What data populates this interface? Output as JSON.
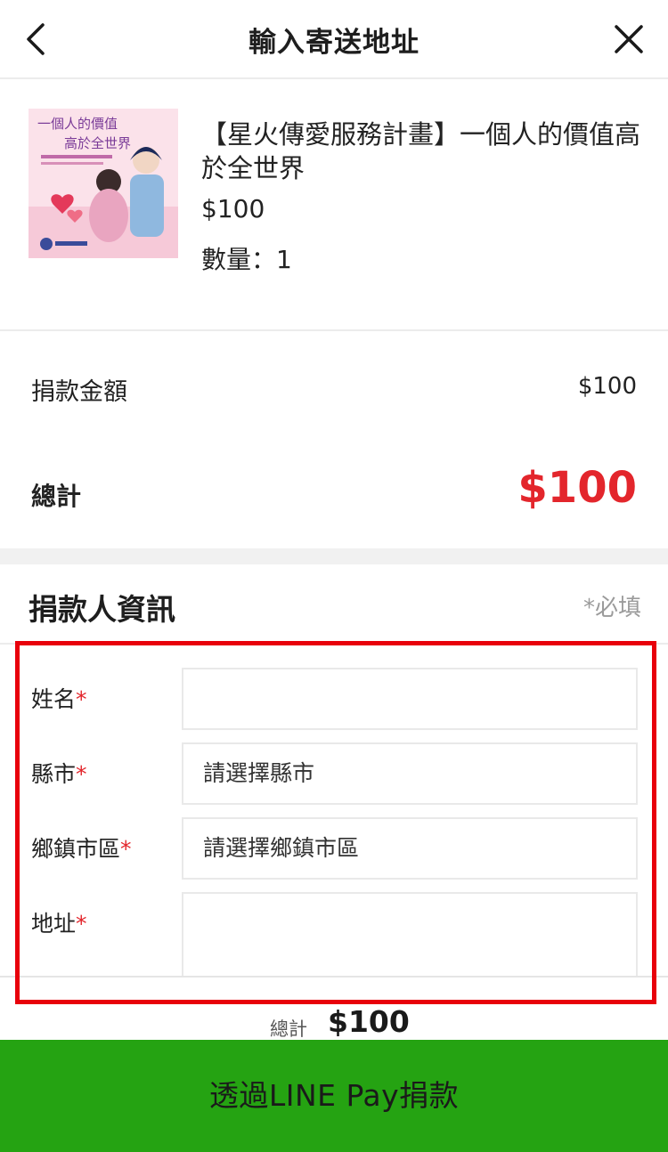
{
  "header": {
    "title": "輸入寄送地址",
    "back_icon": "chevron-left-icon",
    "close_icon": "close-icon"
  },
  "product": {
    "name": "【星火傳愛服務計畫】一個人的價值高於全世界",
    "price": "$100",
    "quantity": "數量：1",
    "thumbnail": {
      "headline_line1": "一個人的價值",
      "headline_line2": "高於全世界"
    }
  },
  "summary": {
    "donation_amount_label": "捐款金額",
    "donation_amount_value": "$100",
    "total_label": "總計",
    "total_value": "$100"
  },
  "donor": {
    "heading": "捐款人資訊",
    "required_note": "*必填",
    "fields": [
      {
        "label": "姓名",
        "required_mark": "*",
        "value": ""
      },
      {
        "label": "縣市",
        "required_mark": "*",
        "value": "請選擇縣市"
      },
      {
        "label": "鄉鎮市區",
        "required_mark": "*",
        "value": "請選擇鄉鎮市區"
      },
      {
        "label": "地址",
        "required_mark": "*",
        "value": ""
      }
    ]
  },
  "footer": {
    "total_label": "總計",
    "total_value": "$100",
    "pay_button_label": "透過LINE Pay捐款"
  },
  "colors": {
    "accent_red": "#e3262c",
    "highlight_red": "#e8000b",
    "pay_green": "#25a312"
  }
}
